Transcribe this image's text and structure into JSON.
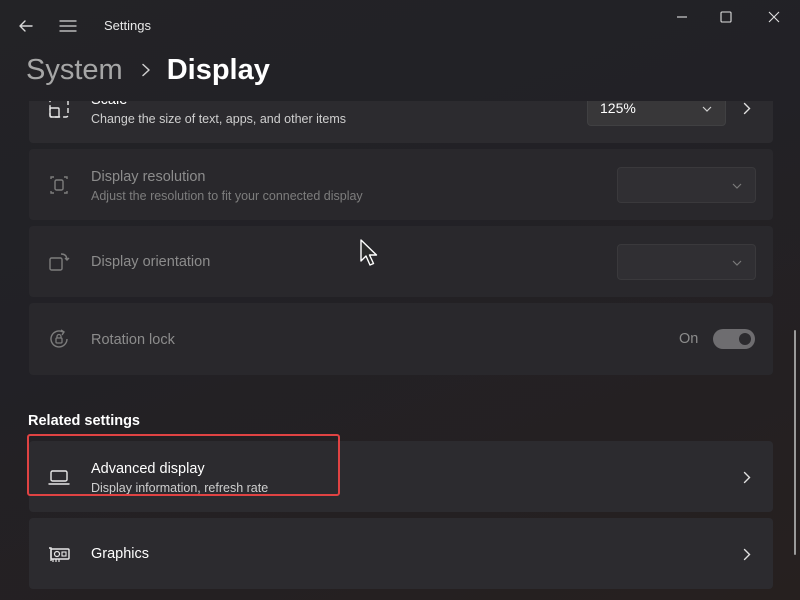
{
  "window": {
    "title": "Settings"
  },
  "breadcrumb": {
    "parent": "System",
    "current": "Display"
  },
  "settings": {
    "scale": {
      "title": "Scale",
      "subtitle": "Change the size of text, apps, and other items",
      "value": "125%"
    },
    "resolution": {
      "title": "Display resolution",
      "subtitle": "Adjust the resolution to fit your connected display",
      "value": ""
    },
    "orientation": {
      "title": "Display orientation",
      "value": ""
    },
    "rotation_lock": {
      "title": "Rotation lock",
      "state_label": "On"
    }
  },
  "related": {
    "heading": "Related settings",
    "advanced_display": {
      "title": "Advanced display",
      "subtitle": "Display information, refresh rate"
    },
    "graphics": {
      "title": "Graphics"
    }
  },
  "colors": {
    "highlight": "#e04343",
    "card": "#2c2b2f"
  }
}
